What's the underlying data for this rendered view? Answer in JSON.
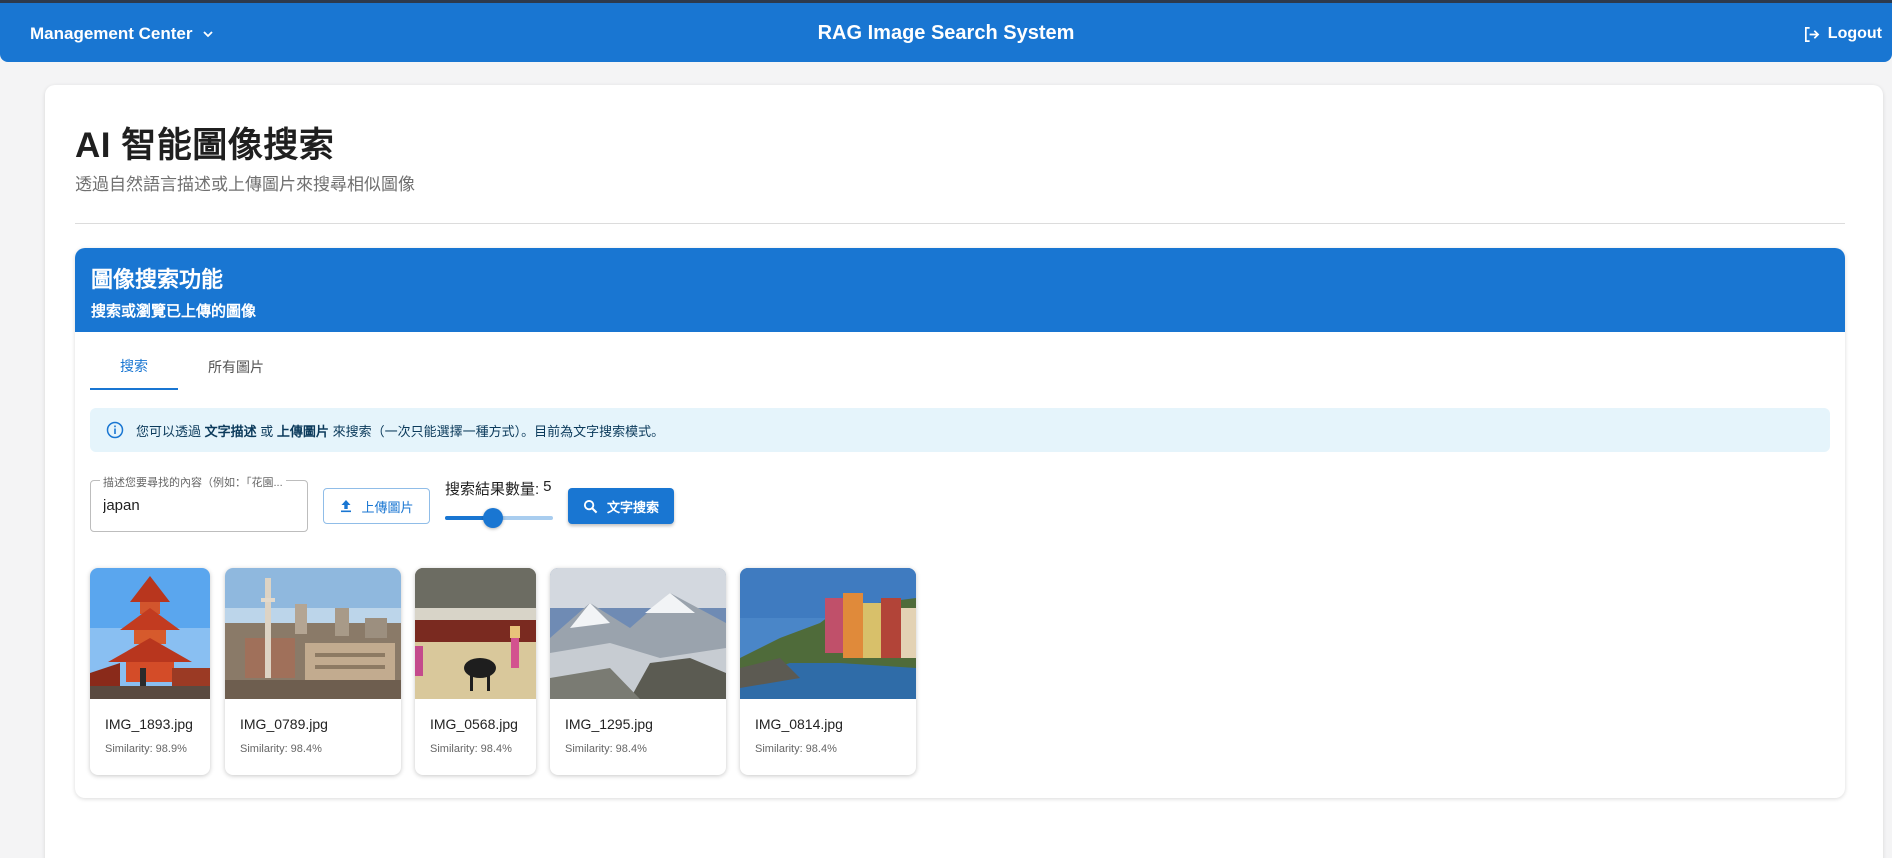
{
  "header": {
    "menu_label": "Management Center",
    "menu_icon": "chevron-down-icon",
    "app_title": "RAG Image Search System",
    "logout_label": "Logout",
    "logout_icon": "logout-icon",
    "bar_color": "#1976d2"
  },
  "page": {
    "title": "AI 智能圖像搜索",
    "subtitle": "透過自然語言描述或上傳圖片來搜尋相似圖像"
  },
  "panel": {
    "title": "圖像搜索功能",
    "subtitle": "搜索或瀏覽已上傳的圖像",
    "tabs": [
      {
        "label": "搜索",
        "active": true
      },
      {
        "label": "所有圖片",
        "active": false
      }
    ],
    "info": {
      "icon": "info-icon",
      "prefix": "您可以透過",
      "bold1": "文字描述",
      "mid": "或",
      "bold2": "上傳圖片",
      "suffix": "來搜索（一次只能選擇一種方式）。目前為文字搜索模式。"
    },
    "search_field": {
      "label": "描述您要尋找的內容（例如：「花園...",
      "value": "japan"
    },
    "upload_button": "上傳圖片",
    "count": {
      "label": "搜索結果數量:",
      "value": "5",
      "slider_fraction": 0.44
    },
    "search_button": "文字搜索"
  },
  "results": [
    {
      "filename": "IMG_1893.jpg",
      "similarity_label": "Similarity:",
      "similarity": "98.9%",
      "scene": "pagoda"
    },
    {
      "filename": "IMG_0789.jpg",
      "similarity_label": "Similarity:",
      "similarity": "98.4%",
      "scene": "city"
    },
    {
      "filename": "IMG_0568.jpg",
      "similarity_label": "Similarity:",
      "similarity": "98.4%",
      "scene": "bullring"
    },
    {
      "filename": "IMG_1295.jpg",
      "similarity_label": "Similarity:",
      "similarity": "98.4%",
      "scene": "mountains"
    },
    {
      "filename": "IMG_0814.jpg",
      "similarity_label": "Similarity:",
      "similarity": "98.4%",
      "scene": "coast"
    }
  ]
}
